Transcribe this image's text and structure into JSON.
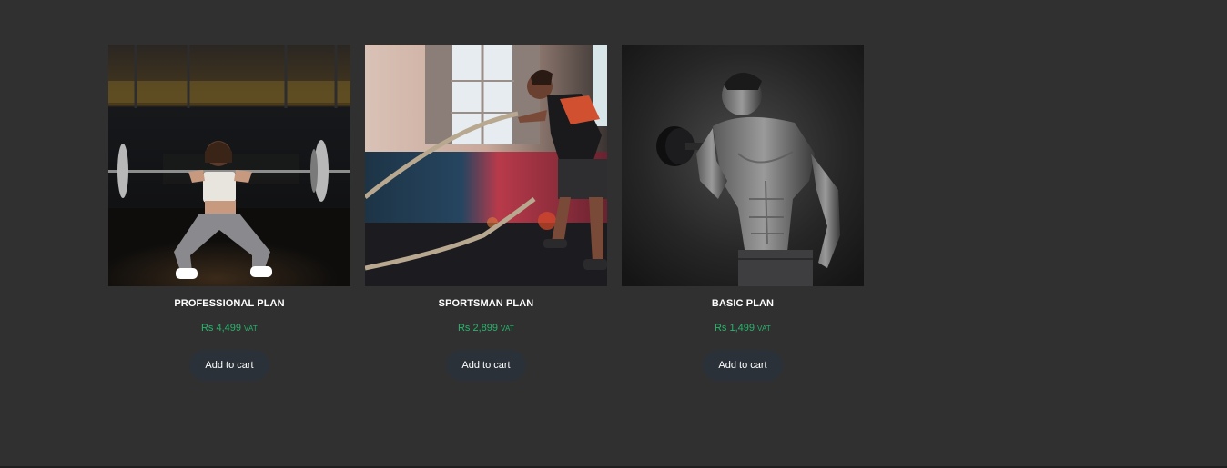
{
  "products": [
    {
      "title": "PROFESSIONAL PLAN",
      "price": "Rs 4,499",
      "price_suffix": "VAT",
      "button_label": "Add to cart",
      "image": "woman-barbell-squat-photo"
    },
    {
      "title": "SPORTSMAN PLAN",
      "price": "Rs 2,899",
      "price_suffix": "VAT",
      "button_label": "Add to cart",
      "image": "man-battle-ropes-photo"
    },
    {
      "title": "BASIC PLAN",
      "price": "Rs 1,499",
      "price_suffix": "VAT",
      "button_label": "Add to cart",
      "image": "man-dumbbell-curl-photo"
    }
  ],
  "colors": {
    "background": "#303030",
    "price": "#28b46c",
    "button_background": "#2b3138",
    "title": "#ffffff"
  }
}
